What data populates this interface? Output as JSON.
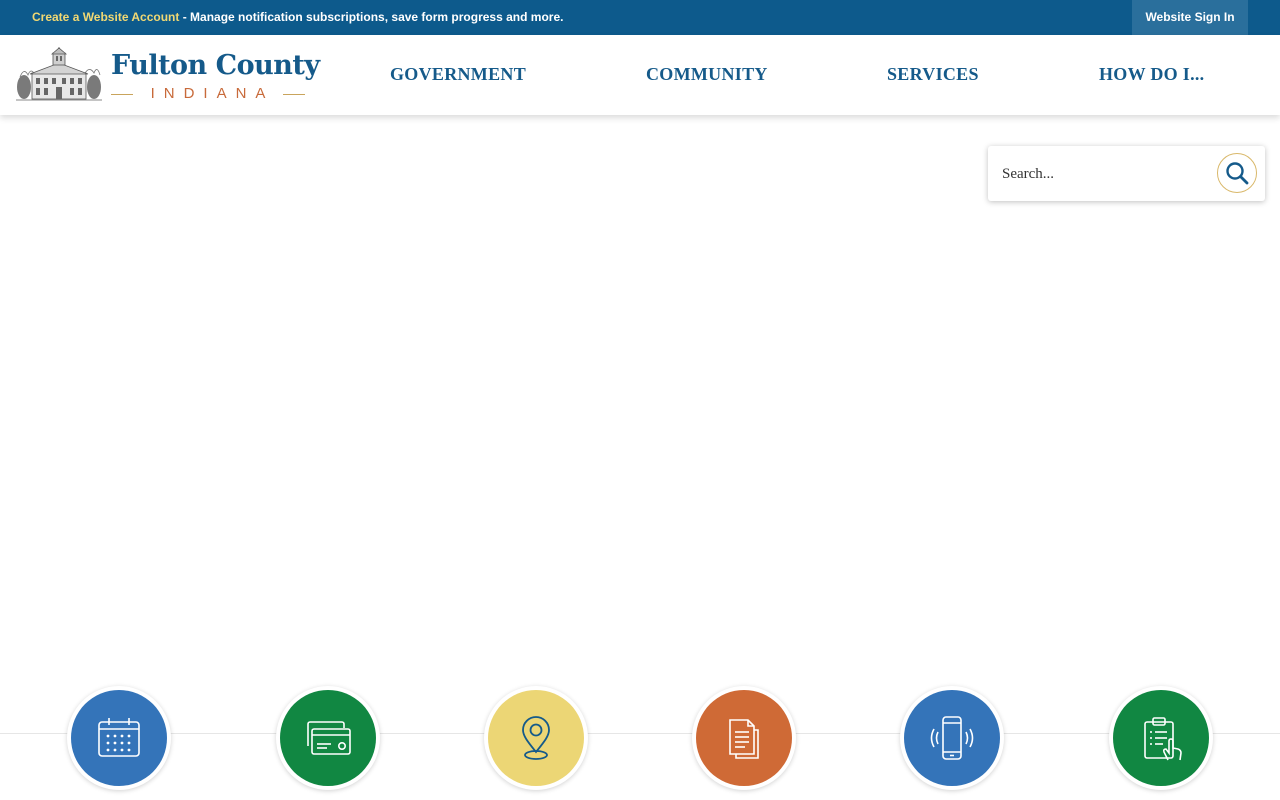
{
  "topbar": {
    "create_account_link": "Create a Website Account",
    "promo_text": " - Manage notification subscriptions, save form progress and more.",
    "sign_in_label": "Website Sign In"
  },
  "logo": {
    "title": "Fulton County",
    "subtitle": "INDIANA",
    "image_icon": "courthouse-illustration"
  },
  "nav": {
    "items": [
      {
        "label": "GOVERNMENT"
      },
      {
        "label": "COMMUNITY"
      },
      {
        "label": "SERVICES"
      },
      {
        "label": "HOW DO I..."
      }
    ]
  },
  "search": {
    "placeholder": "Search...",
    "icon": "search-icon"
  },
  "quick_links": [
    {
      "icon": "calendar-icon",
      "color": "#3474b9"
    },
    {
      "icon": "credit-card-icon",
      "color": "#118742"
    },
    {
      "icon": "map-pin-icon",
      "color": "#ecd675"
    },
    {
      "icon": "documents-icon",
      "color": "#cf6a36"
    },
    {
      "icon": "mobile-phone-icon",
      "color": "#3474b9"
    },
    {
      "icon": "clipboard-checklist-icon",
      "color": "#118742"
    }
  ],
  "colors": {
    "topbar_bg": "#0d5a8c",
    "link_yellow": "#f0d873",
    "nav_blue": "#155a8a",
    "accent_gold": "#d9b86a",
    "accent_orange": "#c86a3a"
  }
}
